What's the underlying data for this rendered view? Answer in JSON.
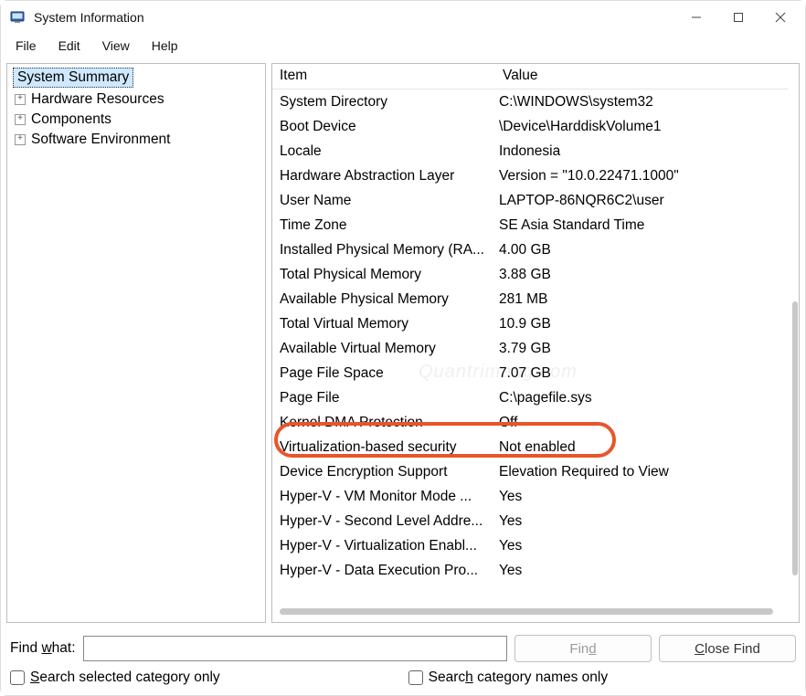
{
  "window": {
    "title": "System Information"
  },
  "menu": {
    "items": [
      "File",
      "Edit",
      "View",
      "Help"
    ]
  },
  "tree": {
    "root": "System Summary",
    "children": [
      "Hardware Resources",
      "Components",
      "Software Environment"
    ]
  },
  "table": {
    "col_item": "Item",
    "col_value": "Value",
    "rows": [
      {
        "item": "System Directory",
        "value": "C:\\WINDOWS\\system32"
      },
      {
        "item": "Boot Device",
        "value": "\\Device\\HarddiskVolume1"
      },
      {
        "item": "Locale",
        "value": "Indonesia"
      },
      {
        "item": "Hardware Abstraction Layer",
        "value": "Version = \"10.0.22471.1000\""
      },
      {
        "item": "User Name",
        "value": "LAPTOP-86NQR6C2\\user"
      },
      {
        "item": "Time Zone",
        "value": "SE Asia Standard Time"
      },
      {
        "item": "Installed Physical Memory (RA...",
        "value": "4.00 GB"
      },
      {
        "item": "Total Physical Memory",
        "value": "3.88 GB"
      },
      {
        "item": "Available Physical Memory",
        "value": "281 MB"
      },
      {
        "item": "Total Virtual Memory",
        "value": "10.9 GB"
      },
      {
        "item": "Available Virtual Memory",
        "value": "3.79 GB"
      },
      {
        "item": "Page File Space",
        "value": "7.07 GB"
      },
      {
        "item": "Page File",
        "value": "C:\\pagefile.sys"
      },
      {
        "item": "Kernel DMA Protection",
        "value": "Off"
      },
      {
        "item": "Virtualization-based security",
        "value": "Not enabled"
      },
      {
        "item": "Device Encryption Support",
        "value": "Elevation Required to View"
      },
      {
        "item": "Hyper-V - VM Monitor Mode ...",
        "value": "Yes"
      },
      {
        "item": "Hyper-V - Second Level Addre...",
        "value": "Yes"
      },
      {
        "item": "Hyper-V - Virtualization Enabl...",
        "value": "Yes"
      },
      {
        "item": "Hyper-V - Data Execution Pro...",
        "value": "Yes"
      }
    ],
    "highlight_index": 14
  },
  "footer": {
    "find_label_pre": "Find ",
    "find_label_u": "w",
    "find_label_post": "hat:",
    "find_placeholder": "",
    "find_button_pre": "Fin",
    "find_button_u": "d",
    "close_button_u": "C",
    "close_button_post": "lose Find",
    "chk1_u": "S",
    "chk1_post": "earch selected category only",
    "chk2_pre": "Searc",
    "chk2_u": "h",
    "chk2_post": " category names only"
  },
  "watermark": "Quantrimang.com"
}
